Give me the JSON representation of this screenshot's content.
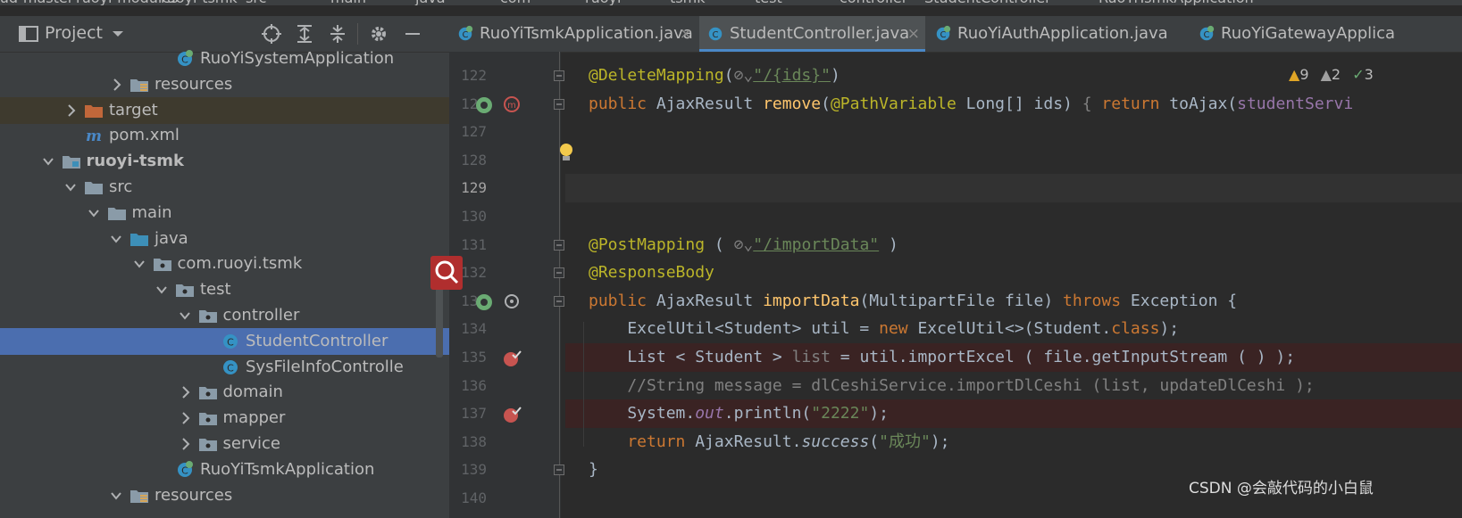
{
  "window": {
    "breadcrumbs": [
      "oud-master",
      "ruoyi-modules",
      "ruoyi-tsmk",
      "src",
      "main",
      "java",
      "com",
      "ruoyi",
      "tsmk",
      "test",
      "controller",
      "StudentController"
    ],
    "run_config": "RuoYiTsmkApplication"
  },
  "project_panel": {
    "title": "Project",
    "tree": [
      {
        "label": "RuoYiSystemApplication",
        "icon": "spring-boot-class-icon",
        "level": 8,
        "arrow": "",
        "style": ""
      },
      {
        "label": "resources",
        "icon": "resources-folder-icon",
        "level": 6,
        "arrow": "right",
        "style": ""
      },
      {
        "label": "target",
        "icon": "excluded-folder-icon",
        "level": 4,
        "arrow": "right",
        "style": "excluded"
      },
      {
        "label": "pom.xml",
        "icon": "maven-icon",
        "level": 4,
        "arrow": "",
        "style": ""
      },
      {
        "label": "ruoyi-tsmk",
        "icon": "module-folder-icon",
        "level": 3,
        "arrow": "down",
        "style": "bold"
      },
      {
        "label": "src",
        "icon": "folder-icon",
        "level": 4,
        "arrow": "down",
        "style": ""
      },
      {
        "label": "main",
        "icon": "folder-icon",
        "level": 5,
        "arrow": "down",
        "style": ""
      },
      {
        "label": "java",
        "icon": "source-folder-icon",
        "level": 6,
        "arrow": "down",
        "style": ""
      },
      {
        "label": "com.ruoyi.tsmk",
        "icon": "package-icon",
        "level": 7,
        "arrow": "down",
        "style": ""
      },
      {
        "label": "test",
        "icon": "package-icon",
        "level": 8,
        "arrow": "down",
        "style": ""
      },
      {
        "label": "controller",
        "icon": "package-icon",
        "level": 9,
        "arrow": "down",
        "style": ""
      },
      {
        "label": "StudentController",
        "icon": "class-icon",
        "level": 10,
        "arrow": "",
        "style": "selected"
      },
      {
        "label": "SysFileInfoControlle",
        "icon": "class-icon",
        "level": 10,
        "arrow": "",
        "style": ""
      },
      {
        "label": "domain",
        "icon": "package-icon",
        "level": 9,
        "arrow": "right",
        "style": ""
      },
      {
        "label": "mapper",
        "icon": "package-icon",
        "level": 9,
        "arrow": "right",
        "style": ""
      },
      {
        "label": "service",
        "icon": "package-icon",
        "level": 9,
        "arrow": "right",
        "style": ""
      },
      {
        "label": "RuoYiTsmkApplication",
        "icon": "spring-boot-class-icon",
        "level": 8,
        "arrow": "",
        "style": ""
      },
      {
        "label": "resources",
        "icon": "resources-folder-icon",
        "level": 6,
        "arrow": "down",
        "style": ""
      }
    ]
  },
  "tabs": [
    {
      "label": "RuoYiTsmkApplication.java",
      "icon": "spring-boot-class-icon",
      "active": false,
      "closable": true
    },
    {
      "label": "StudentController.java",
      "icon": "class-icon",
      "active": true,
      "closable": true
    },
    {
      "label": "RuoYiAuthApplication.java",
      "icon": "spring-boot-class-icon",
      "active": false,
      "closable": false
    },
    {
      "label": "RuoYiGatewayApplica",
      "icon": "spring-boot-class-icon",
      "active": false,
      "closable": false
    }
  ],
  "inspections": {
    "warnings": "9",
    "weak_warnings": "2",
    "typos": "3"
  },
  "code_lines": [
    {
      "num": "122",
      "kind": "",
      "tokens": [
        [
          "a",
          "@DeleteMapping"
        ],
        [
          "",
          "("
        ],
        [
          "c",
          "⊘⌄"
        ],
        [
          "s u",
          "\"/{ids}\""
        ],
        [
          "",
          ")"
        ]
      ]
    },
    {
      "num": "123",
      "kind": "",
      "tokens": [
        [
          "k",
          "public "
        ],
        [
          "",
          "AjaxResult "
        ],
        [
          "f",
          "remove"
        ],
        [
          "",
          "("
        ],
        [
          "a",
          "@PathVariable "
        ],
        [
          "",
          "Long[] ids) "
        ],
        [
          "c",
          "{ "
        ],
        [
          "k",
          "return "
        ],
        [
          "",
          "toAjax("
        ],
        [
          "m",
          "studentServi"
        ]
      ]
    },
    {
      "num": "127",
      "kind": "",
      "tokens": []
    },
    {
      "num": "128",
      "kind": "",
      "tokens": []
    },
    {
      "num": "129",
      "kind": "current",
      "tokens": []
    },
    {
      "num": "130",
      "kind": "",
      "tokens": []
    },
    {
      "num": "131",
      "kind": "",
      "tokens": [
        [
          "a",
          "@PostMapping "
        ],
        [
          "",
          "( "
        ],
        [
          "c",
          "⊘⌄"
        ],
        [
          "s u",
          "\"/importData\""
        ],
        [
          "",
          " )"
        ]
      ]
    },
    {
      "num": "132",
      "kind": "",
      "tokens": [
        [
          "a",
          "@ResponseBody"
        ]
      ]
    },
    {
      "num": "133",
      "kind": "",
      "tokens": [
        [
          "k",
          "public "
        ],
        [
          "",
          "AjaxResult "
        ],
        [
          "f",
          "importData"
        ],
        [
          "",
          "(MultipartFile file) "
        ],
        [
          "k",
          "throws "
        ],
        [
          "",
          "Exception {"
        ]
      ]
    },
    {
      "num": "134",
      "kind": "",
      "tokens": [
        [
          "",
          "    ExcelUtil<Student> util = "
        ],
        [
          "k",
          "new "
        ],
        [
          "",
          "ExcelUtil<>(Student."
        ],
        [
          "k",
          "class"
        ],
        [
          "",
          ");"
        ]
      ]
    },
    {
      "num": "135",
      "kind": "breakpoint",
      "tokens": [
        [
          "",
          "    List < Student > "
        ],
        [
          "c",
          "list"
        ],
        [
          "",
          " = util.importExcel ( file.getInputStream ( ) );"
        ]
      ]
    },
    {
      "num": "136",
      "kind": "",
      "tokens": [
        [
          "c",
          "    //String message = dlCeshiService.importDlCeshi (list, updateDlCeshi );"
        ]
      ]
    },
    {
      "num": "137",
      "kind": "breakpoint",
      "tokens": [
        [
          "",
          "    System."
        ],
        [
          "m i",
          "out"
        ],
        [
          "",
          ".println("
        ],
        [
          "s",
          "\"2222\""
        ],
        [
          "",
          ");"
        ]
      ]
    },
    {
      "num": "138",
      "kind": "",
      "tokens": [
        [
          "k",
          "    return "
        ],
        [
          "",
          "AjaxResult."
        ],
        [
          "i",
          "success"
        ],
        [
          "",
          "("
        ],
        [
          "s",
          "\"成功\""
        ],
        [
          "",
          ");"
        ]
      ]
    },
    {
      "num": "139",
      "kind": "",
      "tokens": [
        [
          "",
          "}"
        ]
      ]
    },
    {
      "num": "140",
      "kind": "",
      "tokens": []
    }
  ],
  "watermark": "CSDN @会敲代码的小白鼠",
  "colors": {
    "selection": "#4b6eaf",
    "breakpoint": "#c75450",
    "keyword": "#cc7832",
    "annotation": "#bbb529",
    "string": "#6a8759"
  }
}
